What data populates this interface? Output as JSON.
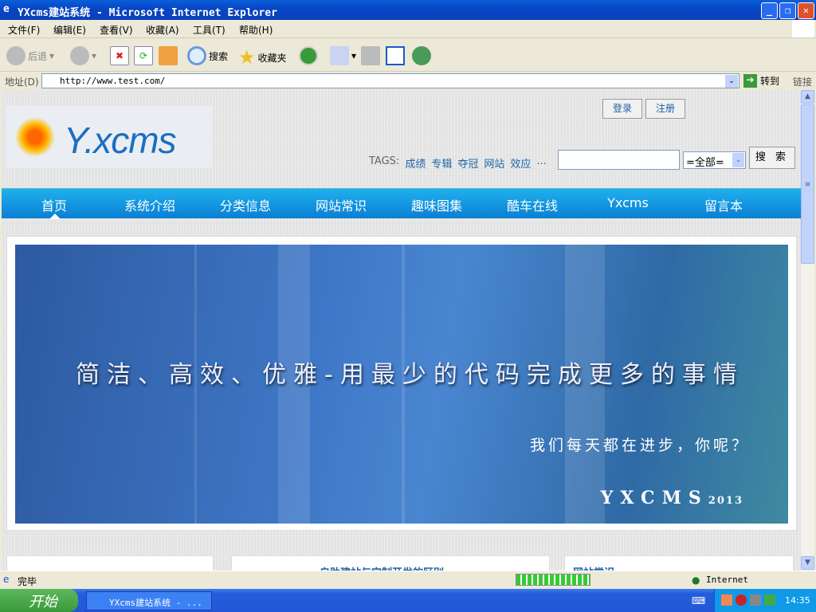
{
  "window": {
    "title": "YXcms建站系统 - Microsoft Internet Explorer"
  },
  "menu": [
    "文件(F)",
    "编辑(E)",
    "查看(V)",
    "收藏(A)",
    "工具(T)",
    "帮助(H)"
  ],
  "toolbar": {
    "back": "后退",
    "search": "搜索",
    "favorites": "收藏夹"
  },
  "address": {
    "label": "地址(D)",
    "url": "http://www.test.com/",
    "go": "转到",
    "links": "链接"
  },
  "header": {
    "login": "登录",
    "register": "注册",
    "tags_label": "TAGS:",
    "tags": [
      "成绩",
      "专辑",
      "夺冠",
      "网站",
      "效应"
    ],
    "tags_more": "...",
    "search_value": "",
    "select_value": "=全部=",
    "search_button": "搜 索"
  },
  "nav": [
    "首页",
    "系统介绍",
    "分类信息",
    "网站常识",
    "趣味图集",
    "酷车在线",
    "Yxcms",
    "留言本"
  ],
  "banner": {
    "slogan": "简洁、高效、优雅-用最少的代码完成更多的事情",
    "sub": "我们每天都在进步，你呢？",
    "brand": "YXCMS",
    "year": "2013"
  },
  "logo": "Y.xcms",
  "panels": {
    "middle": "自助建站与定制开发的区别",
    "right": "网站常识"
  },
  "status": {
    "text": "完毕",
    "zone": "Internet",
    "progress": 1.0
  },
  "taskbar": {
    "start": "开始",
    "task": "YXcms建站系统 - ...",
    "time": "14:35"
  }
}
